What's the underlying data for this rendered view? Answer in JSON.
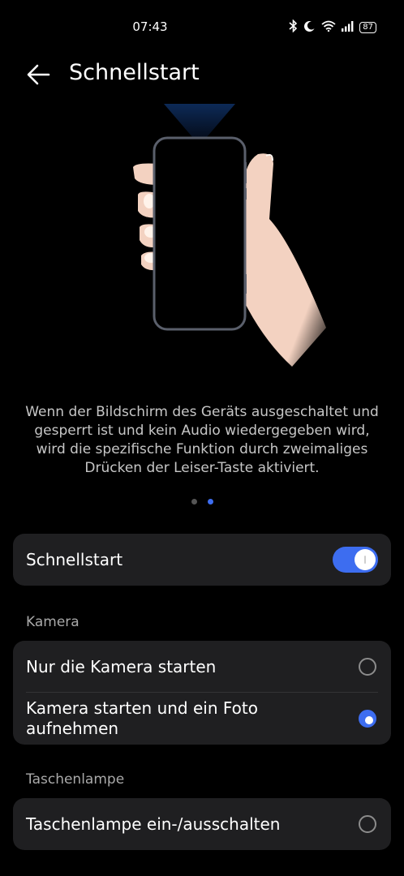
{
  "status_bar": {
    "time": "07:43",
    "icons": [
      "bluetooth-icon",
      "moon-icon",
      "wifi-icon",
      "signal-icon"
    ],
    "battery": "87"
  },
  "header": {
    "back_icon": "arrow-left-icon",
    "title": "Schnellstart"
  },
  "description": "Wenn der Bildschirm des Geräts ausgeschaltet und gesperrt ist und kein Audio wiedergegeben wird, wird die spezifische Funktion durch zweimaliges Drücken der Leiser-Taste aktiviert.",
  "pager": {
    "count": 2,
    "active_index": 1
  },
  "main_toggle": {
    "label": "Schnellstart",
    "enabled": true
  },
  "camera_section": {
    "title": "Kamera",
    "options": [
      {
        "label": "Nur die Kamera starten",
        "selected": false
      },
      {
        "label": "Kamera starten und ein Foto aufnehmen",
        "selected": true
      }
    ]
  },
  "flashlight_section": {
    "title": "Taschenlampe",
    "options": [
      {
        "label": "Taschenlampe ein-/ausschalten",
        "selected": false
      }
    ]
  },
  "colors": {
    "accent": "#3d6df0",
    "card": "#1f1f21",
    "background": "#000000"
  }
}
